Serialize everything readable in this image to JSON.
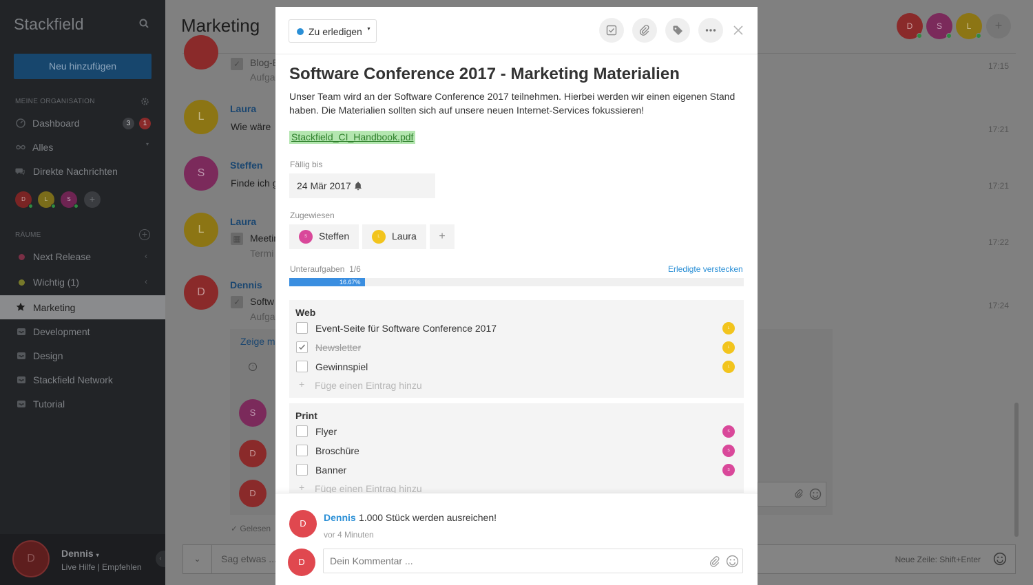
{
  "sidebar": {
    "brand": "Stackfield",
    "add_button": "Neu hinzufügen",
    "section_org": "MEINE ORGANISATION",
    "section_rooms": "RÄUME",
    "org_items": [
      {
        "label": "Dashboard",
        "badge_a": "3",
        "badge_b": "1"
      },
      {
        "label": "Alles"
      },
      {
        "label": "Direkte Nachrichten"
      }
    ],
    "contacts": [
      "D",
      "L",
      "S"
    ],
    "rooms": [
      {
        "label": "Next Release",
        "color": "#7a2f45"
      },
      {
        "label": "Wichtig (1)",
        "color": "#77792a"
      },
      {
        "label": "Marketing"
      },
      {
        "label": "Development"
      },
      {
        "label": "Design"
      },
      {
        "label": "Stackfield Network"
      },
      {
        "label": "Tutorial"
      }
    ],
    "user": {
      "initial": "D",
      "name": "Dennis",
      "links": "Live Hilfe | Empfehlen"
    }
  },
  "main": {
    "title": "Marketing",
    "top_avatars": [
      "D",
      "S",
      "L"
    ],
    "messages": [
      {
        "initial": "",
        "name": "",
        "text": "Blog-B",
        "sub": "Aufga",
        "time": "17:15"
      },
      {
        "initial": "L",
        "name": "Laura",
        "text": "Wie wäre",
        "time": "17:21"
      },
      {
        "initial": "S",
        "name": "Steffen",
        "text": "Finde ich g",
        "time": "17:21"
      },
      {
        "initial": "L",
        "name": "Laura",
        "text": "Meetin",
        "sub": "Termi",
        "time": "17:22"
      },
      {
        "initial": "D",
        "name": "Dennis",
        "text": "Softw",
        "sub": "Aufga",
        "time": "17:24"
      }
    ],
    "thread_link": "Zeige m",
    "thread_avatars": [
      "S",
      "D",
      "D"
    ],
    "read_label": "Gelesen",
    "compose_placeholder": "Sag etwas ...",
    "compose_hint": "Neue Zeile: Shift+Enter"
  },
  "modal": {
    "status": "Zu erledigen",
    "status_color": "#2a8fd6",
    "title": "Software Conference 2017 - Marketing Materialien",
    "description": "Unser Team wird an der Software Conference 2017 teilnehmen. Hierbei werden wir einen eigenen Stand haben. Die Materialien sollten sich auf unsere neuen Internet-Services fokussieren!",
    "attachment": "Stackfield_CI_Handbook.pdf",
    "due_label": "Fällig bis",
    "due_date": "24 Mär 2017",
    "assigned_label": "Zugewiesen",
    "assignees": [
      {
        "initial": "S",
        "name": "Steffen",
        "color": "#d9489a"
      },
      {
        "initial": "L",
        "name": "Laura",
        "color": "#f2c41d"
      }
    ],
    "subtasks_label": "Unteraufgaben",
    "subtasks_count": "1/6",
    "hide_done": "Erledigte verstecken",
    "progress_text": "16.67%",
    "progress_value": 0.1667,
    "groups": [
      {
        "title": "Web",
        "tasks": [
          {
            "text": "Event-Seite für Software Conference 2017",
            "done": false,
            "assignee": "L"
          },
          {
            "text": "Newsletter",
            "done": true,
            "assignee": "L"
          },
          {
            "text": "Gewinnspiel",
            "done": false,
            "assignee": "L"
          }
        ],
        "add_placeholder": "Füge einen Eintrag hinzu"
      },
      {
        "title": "Print",
        "tasks": [
          {
            "text": "Flyer",
            "done": false,
            "assignee": "S"
          },
          {
            "text": "Broschüre",
            "done": false,
            "assignee": "S"
          },
          {
            "text": "Banner",
            "done": false,
            "assignee": "S"
          }
        ],
        "add_placeholder": "Füge einen Eintrag hinzu"
      }
    ],
    "comment": {
      "initial": "D",
      "author": "Dennis",
      "text": "1.000 Stück werden ausreichen!",
      "time": "vor 4 Minuten"
    },
    "my_initial": "D",
    "comment_placeholder": "Dein Kommentar ..."
  },
  "colors": {
    "accent": "#2a8fd6",
    "avatar_dennis": "#e0484f",
    "avatar_steffen": "#d9489a",
    "avatar_laura": "#f2c41d"
  }
}
